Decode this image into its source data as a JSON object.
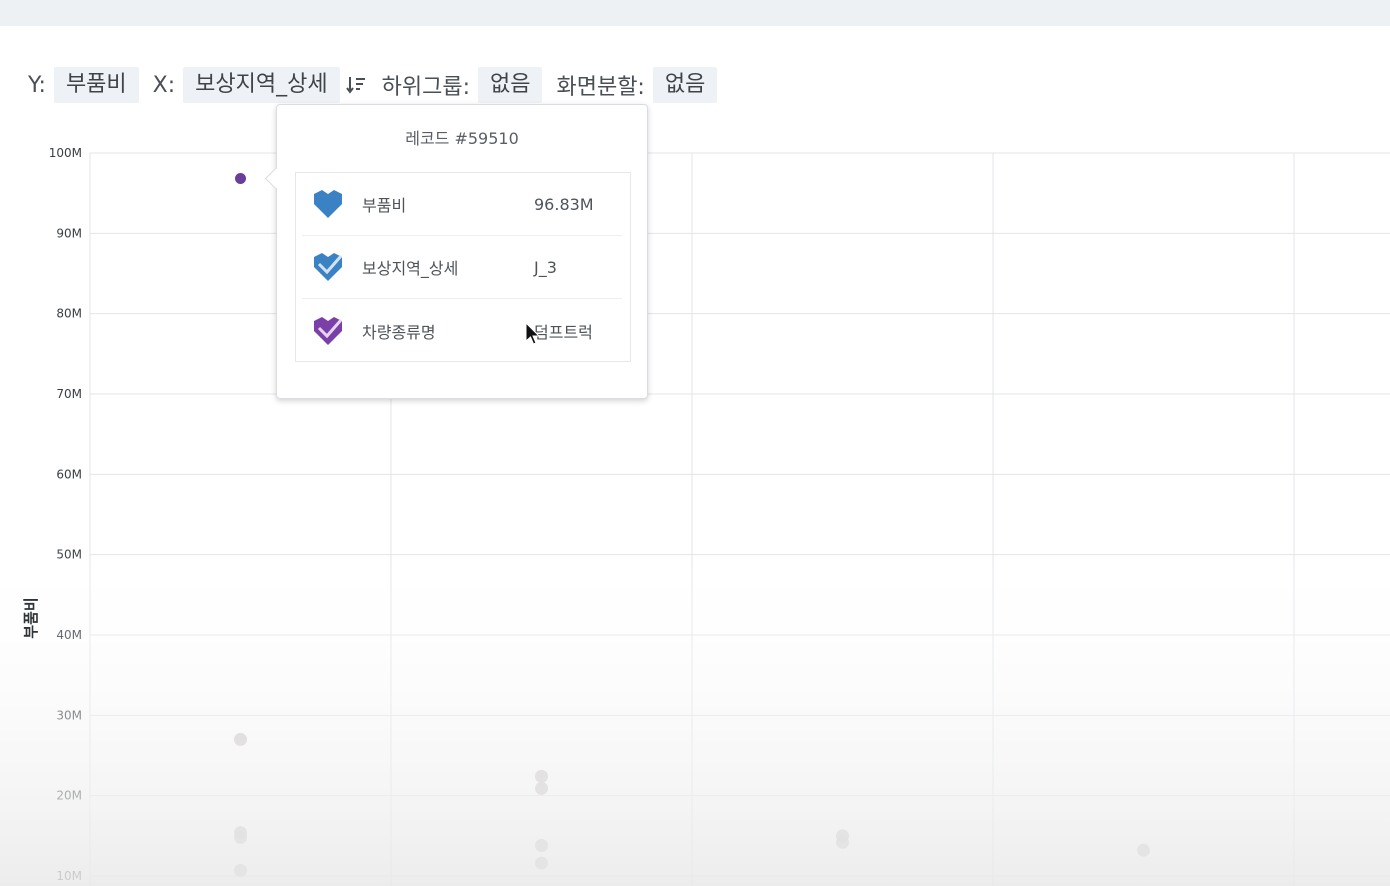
{
  "config": {
    "y_label": "Y:",
    "y_value": "부품비",
    "x_label": "X:",
    "x_value": "보상지역_상세",
    "subgroup_label": "하위그룹:",
    "subgroup_value": "없음",
    "split_label": "화면분할:",
    "split_value": "없음"
  },
  "tooltip": {
    "title": "레코드 #59510",
    "rows": [
      {
        "key": "부품비",
        "value": "96.83M",
        "icon": "blue-heart-icon"
      },
      {
        "key": "보상지역_상세",
        "value": "J_3",
        "icon": "blue-check-heart-icon"
      },
      {
        "key": "차량종류명",
        "value": "덤프트럭",
        "icon": "purple-check-heart-icon"
      }
    ]
  },
  "colors": {
    "highlight": "#6a3d9a",
    "muted_point": "#c9c4c4",
    "grid": "#e2e5e8",
    "blue_icon": "#3b82c4",
    "purple_icon": "#7b3fa8"
  },
  "chart_data": {
    "type": "scatter",
    "ylabel": "부품비",
    "xlabel": "",
    "ylim": [
      10,
      100
    ],
    "y_ticks": [
      "100M",
      "90M",
      "80M",
      "70M",
      "60M",
      "50M",
      "40M",
      "30M",
      "20M",
      "10M"
    ],
    "y_tick_values": [
      100,
      90,
      80,
      70,
      60,
      50,
      40,
      30,
      20,
      10
    ],
    "category_count": 4,
    "series": [
      {
        "points": [
          {
            "category": 0,
            "y": 96.83,
            "highlight": true
          },
          {
            "category": 0,
            "y": 27.0
          },
          {
            "category": 0,
            "y": 15.4
          },
          {
            "category": 0,
            "y": 14.8
          },
          {
            "category": 0,
            "y": 10.7
          },
          {
            "category": 1,
            "y": 22.4
          },
          {
            "category": 1,
            "y": 20.9
          },
          {
            "category": 1,
            "y": 13.8
          },
          {
            "category": 1,
            "y": 11.6
          },
          {
            "category": 2,
            "y": 15.0
          },
          {
            "category": 2,
            "y": 14.2
          },
          {
            "category": 3,
            "y": 13.2
          }
        ]
      }
    ]
  }
}
